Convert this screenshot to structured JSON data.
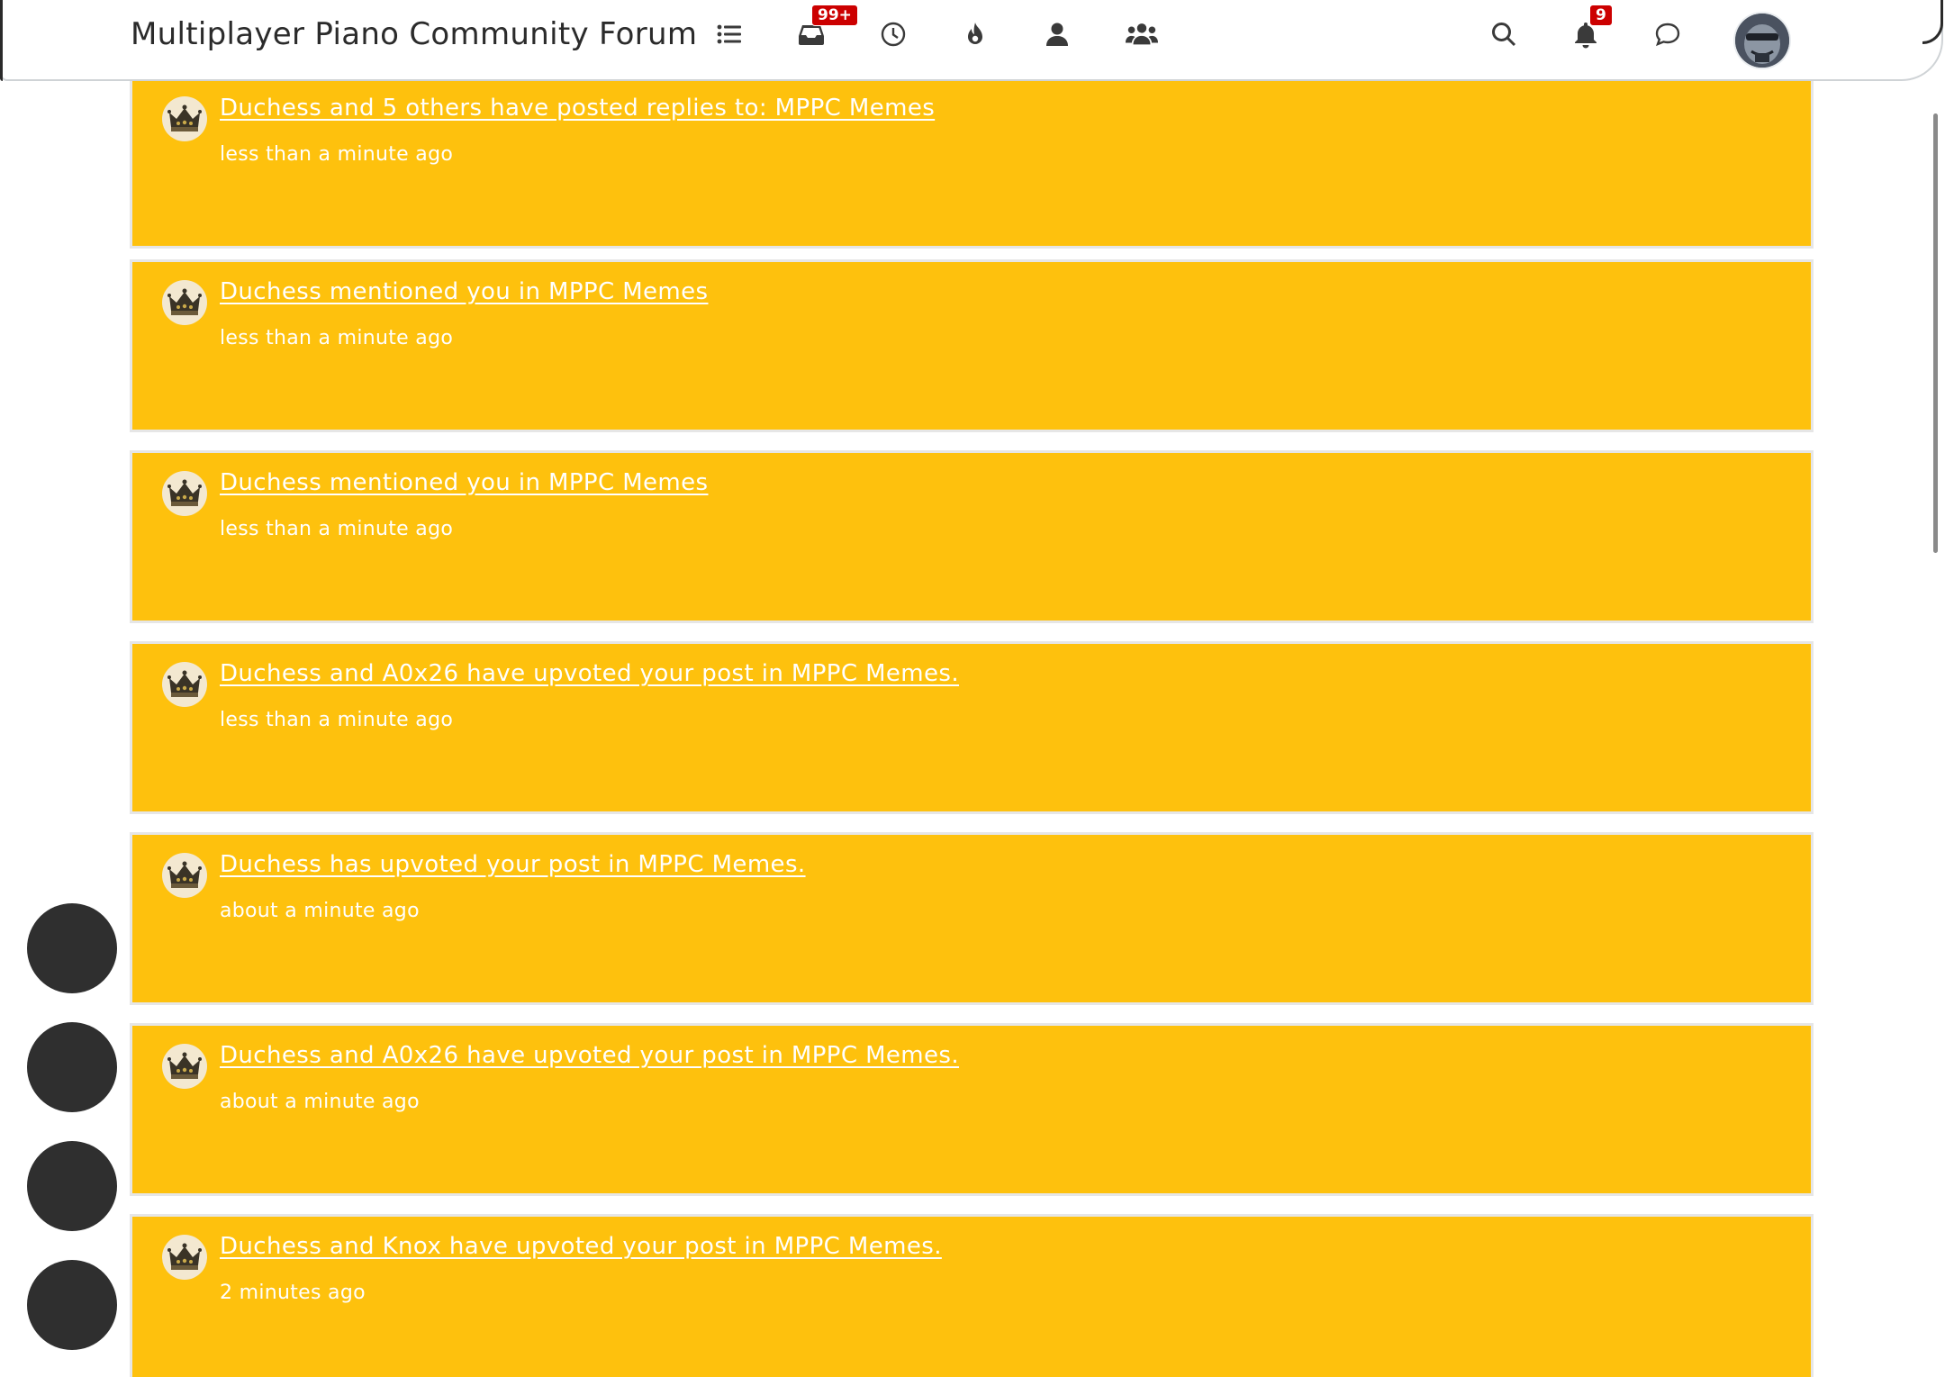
{
  "navbar": {
    "brand": "Multiplayer Piano Community Forum",
    "icons": [
      {
        "name": "categories-list-icon"
      },
      {
        "name": "unread-inbox-icon",
        "badge": "99+"
      },
      {
        "name": "recent-clock-icon"
      },
      {
        "name": "popular-fire-icon"
      },
      {
        "name": "user-icon"
      },
      {
        "name": "groups-icon"
      }
    ],
    "right_icons": [
      {
        "name": "search-icon"
      },
      {
        "name": "notifications-bell-icon",
        "badge": "9"
      },
      {
        "name": "chat-bubble-icon"
      }
    ],
    "avatar": "user-avatar"
  },
  "colors": {
    "notification_bg": "#fec10d",
    "notification_border": "#e6e6e6",
    "badge": "#cc0000",
    "fab": "#2f2f2f"
  },
  "notifications": [
    {
      "title": "Duchess and 5 others have posted replies to: MPPC Memes",
      "time": "less than a minute ago"
    },
    {
      "title": "Duchess mentioned you in MPPC Memes",
      "time": "less than a minute ago"
    },
    {
      "title": "Duchess mentioned you in MPPC Memes",
      "time": "less than a minute ago"
    },
    {
      "title": "Duchess and A0x26 have upvoted your post in MPPC Memes.",
      "time": "less than a minute ago"
    },
    {
      "title": "Duchess has upvoted your post in MPPC Memes.",
      "time": "about a minute ago"
    },
    {
      "title": "Duchess and A0x26 have upvoted your post in MPPC Memes.",
      "time": "about a minute ago"
    },
    {
      "title": "Duchess and Knox have upvoted your post in MPPC Memes.",
      "time": "2 minutes ago"
    }
  ]
}
